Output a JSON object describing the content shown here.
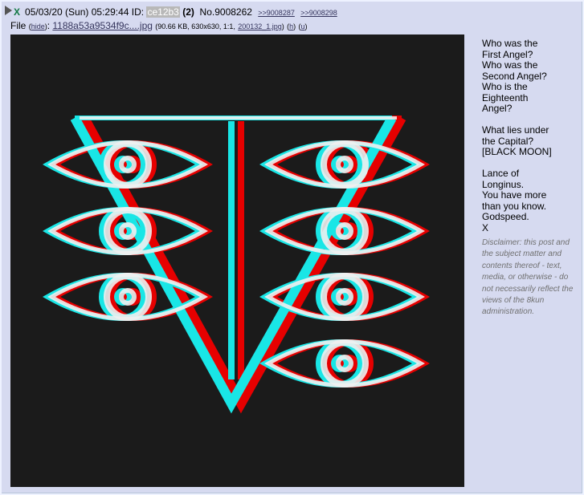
{
  "post": {
    "poster_name": "X",
    "datetime": "05/03/20 (Sun) 05:29:44",
    "id_label": "ID:",
    "poster_id": "ce12b3",
    "post_count": "(2)",
    "post_number": "No.9008262",
    "backlinks": [
      ">>9008287",
      ">>9008298"
    ]
  },
  "file": {
    "label": "File",
    "hide_label": "hide",
    "filename": "1188a53a9534f9c....jpg",
    "meta": "(90.66 KB, 630x630, 1:1,",
    "orig_name": "200132_1.jpg",
    "h_label": "h",
    "u_label": "u",
    "image_alt": "seele-eyes-logo"
  },
  "body_lines": [
    "Who was the",
    "First Angel?",
    "Who was the",
    "Second Angel?",
    "Who is the",
    "Eighteenth",
    "Angel?",
    "",
    "What lies under",
    "the Capital?",
    "[BLACK MOON]",
    "",
    "Lance of",
    "Longinus.",
    "You have more",
    "than you know.",
    "Godspeed.",
    "X"
  ],
  "disclaimer": "Disclaimer: this post and the subject matter and contents thereof - text, media, or otherwise - do not necessarily reflect the views of the 8kun administration.",
  "colors": {
    "post_bg": "#d6daf0",
    "page_bg": "#eef2ff",
    "name_green": "#117743",
    "link": "#34345c",
    "cyan": "#19e6e6",
    "red": "#e60000",
    "white": "#f0f0f0",
    "image_bg": "#1b1b1b"
  }
}
